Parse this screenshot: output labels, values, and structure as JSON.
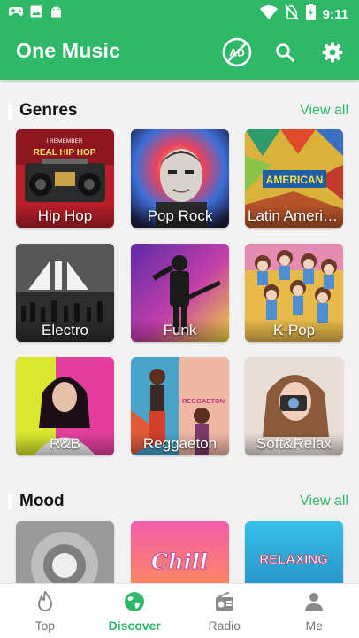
{
  "status_bar": {
    "time": "9:11",
    "icons": [
      "gamepad-icon",
      "image-icon",
      "android-icon",
      "wifi-icon",
      "no-sim-icon",
      "battery-charging-icon"
    ]
  },
  "app_bar": {
    "title": "One Music",
    "ad_icon_text": "AD",
    "actions": [
      "no-ads-icon",
      "search-icon",
      "gear-icon"
    ]
  },
  "sections": {
    "genres": {
      "title": "Genres",
      "view_all": "View all",
      "tiles": [
        {
          "label": "Hip Hop",
          "art_text": "I REMEMBER REAL HIP HOP"
        },
        {
          "label": "Pop Rock"
        },
        {
          "label": "Latin Americ...",
          "art_text": "AMERICAN"
        },
        {
          "label": "Electro"
        },
        {
          "label": "Funk"
        },
        {
          "label": "K-Pop"
        },
        {
          "label": "R&B"
        },
        {
          "label": "Reggaeton",
          "art_text": "REGGAETON"
        },
        {
          "label": "Soft&Relax"
        }
      ]
    },
    "mood": {
      "title": "Mood",
      "view_all": "View all",
      "tiles": [
        {
          "label": ""
        },
        {
          "label": "",
          "art_text": "Chill"
        },
        {
          "label": "",
          "art_text": "RELAXING"
        }
      ]
    }
  },
  "bottom_nav": {
    "items": [
      {
        "label": "Top",
        "icon": "flame-icon"
      },
      {
        "label": "Discover",
        "icon": "globe-icon",
        "active": true
      },
      {
        "label": "Radio",
        "icon": "radio-icon"
      },
      {
        "label": "Me",
        "icon": "person-icon"
      }
    ]
  },
  "colors": {
    "accent": "#2fb867",
    "background": "#f2f2f2",
    "nav_inactive": "#777777"
  }
}
